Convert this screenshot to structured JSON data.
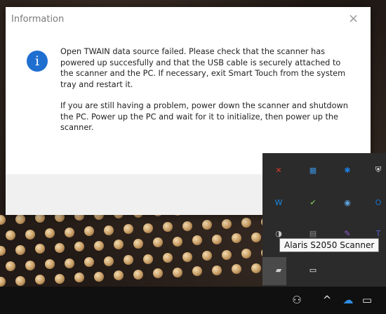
{
  "dialog": {
    "title": "Information",
    "close_glyph": "×",
    "info_glyph": "i",
    "message_paragraph_1": "Open TWAIN data source failed. Please check that the scanner has powered up succesfully and that the USB cable is securely attached to the scanner and the PC. If necessary, exit Smart Touch from the system tray and restart it.",
    "message_paragraph_2": "If you are still having a problem, power down the scanner and shutdown the PC.  Power up the PC and wait for it to initialize, then power up the scanner."
  },
  "tray_flyout": {
    "icons": [
      {
        "name": "app-x-icon",
        "glyph": "✕",
        "color": "#d8392b"
      },
      {
        "name": "app-blue-tile-icon",
        "glyph": "▦",
        "color": "#3a8fd8"
      },
      {
        "name": "bluetooth-icon",
        "glyph": "✱",
        "color": "#1e7fe0"
      },
      {
        "name": "security-shield-icon",
        "glyph": "⛨",
        "color": "#ffffff"
      },
      {
        "name": "waveform-icon",
        "glyph": "W",
        "color": "#1c8ae6"
      },
      {
        "name": "sync-check-icon",
        "glyph": "✔",
        "color": "#6aa84f"
      },
      {
        "name": "steam-icon",
        "glyph": "◉",
        "color": "#5da6e0"
      },
      {
        "name": "outlook-icon",
        "glyph": "O",
        "color": "#1a73c9"
      },
      {
        "name": "disc-icon",
        "glyph": "◑",
        "color": "#c9c9c9"
      },
      {
        "name": "app-small-icon",
        "glyph": "▤",
        "color": "#8a8a8a"
      },
      {
        "name": "app-purple-icon",
        "glyph": "✎",
        "color": "#8e5bd0"
      },
      {
        "name": "teams-icon",
        "glyph": "T",
        "color": "#5b5fc7"
      },
      {
        "name": "scanner-icon",
        "glyph": "▰",
        "color": "#d0d0d0"
      },
      {
        "name": "battery-icon",
        "glyph": "▭",
        "color": "#ffffff"
      }
    ],
    "tooltip": "Alaris S2050 Scanner"
  },
  "taskbar": {
    "people_glyph": "⚇",
    "chevron_glyph": "^",
    "cloud_glyph": "☁",
    "network_glyph": "▭"
  }
}
